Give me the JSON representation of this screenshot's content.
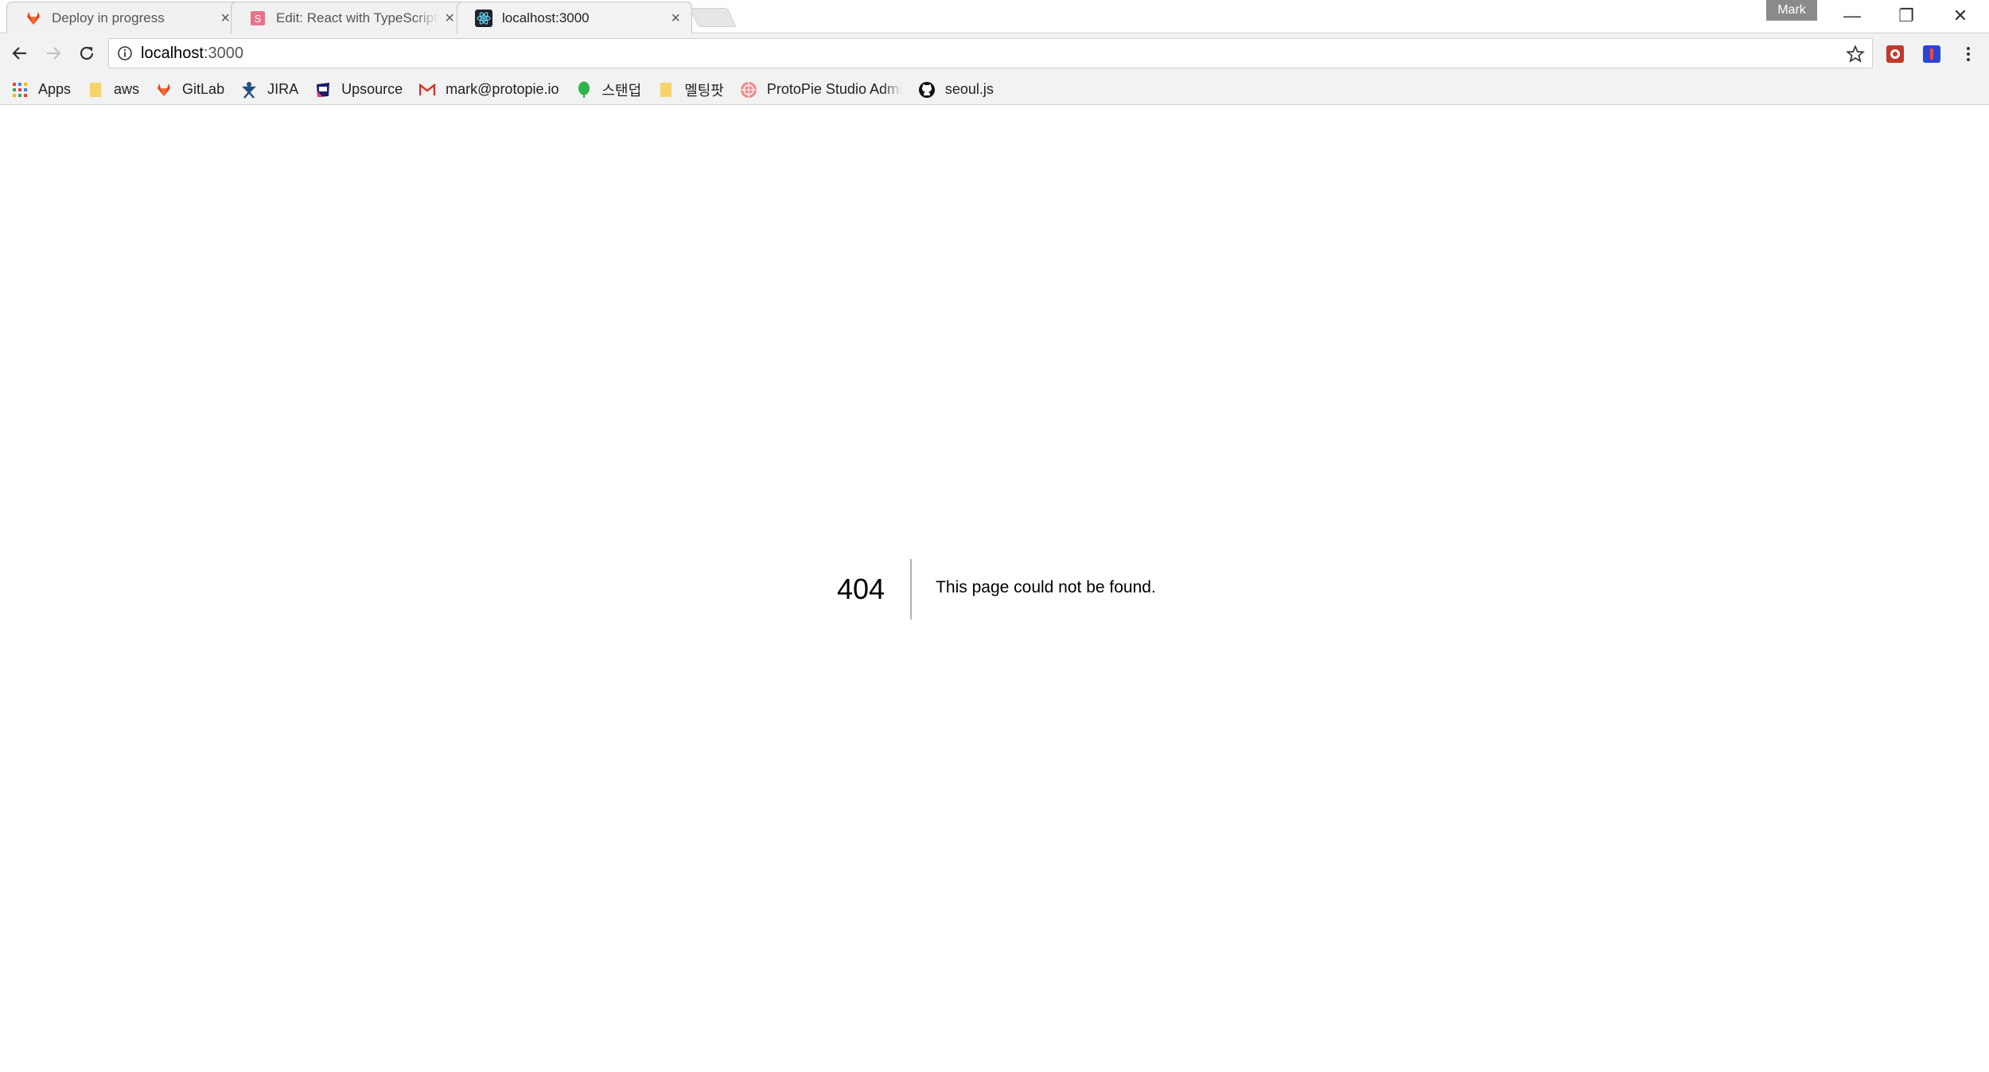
{
  "tabs": [
    {
      "title": "Deploy in progress",
      "icon": "gitlab-icon",
      "active": false
    },
    {
      "title": "Edit: React with TypeScript",
      "icon": "stackblitz-icon",
      "active": false
    },
    {
      "title": "localhost:3000",
      "icon": "react-icon",
      "active": true
    }
  ],
  "profile": {
    "name": "Mark"
  },
  "window_controls": {
    "minimize": "—",
    "restore": "❐",
    "close": "✕"
  },
  "tab_close_glyph": "×",
  "omnibox": {
    "host": "localhost",
    "port": ":3000"
  },
  "bookmarks": [
    {
      "label": "Apps",
      "icon": "apps-grid-icon"
    },
    {
      "label": "aws",
      "icon": "folder-icon"
    },
    {
      "label": "GitLab",
      "icon": "gitlab-icon"
    },
    {
      "label": "JIRA",
      "icon": "jira-icon"
    },
    {
      "label": "Upsource",
      "icon": "upsource-icon"
    },
    {
      "label": "mark@protopie.io",
      "icon": "gmail-icon"
    },
    {
      "label": "스탠덥",
      "icon": "leaf-icon"
    },
    {
      "label": "멜팅팟",
      "icon": "folder-icon"
    },
    {
      "label": "ProtoPie Studio Admin",
      "icon": "protopie-icon"
    },
    {
      "label": "seoul.js",
      "icon": "github-icon"
    }
  ],
  "error": {
    "code": "404",
    "message": "This page could not be found."
  },
  "colors": {
    "gitlab": "#e24329",
    "react": "#61dafb",
    "stackblitz": "#e7728a",
    "folder": "#f6d36b"
  }
}
